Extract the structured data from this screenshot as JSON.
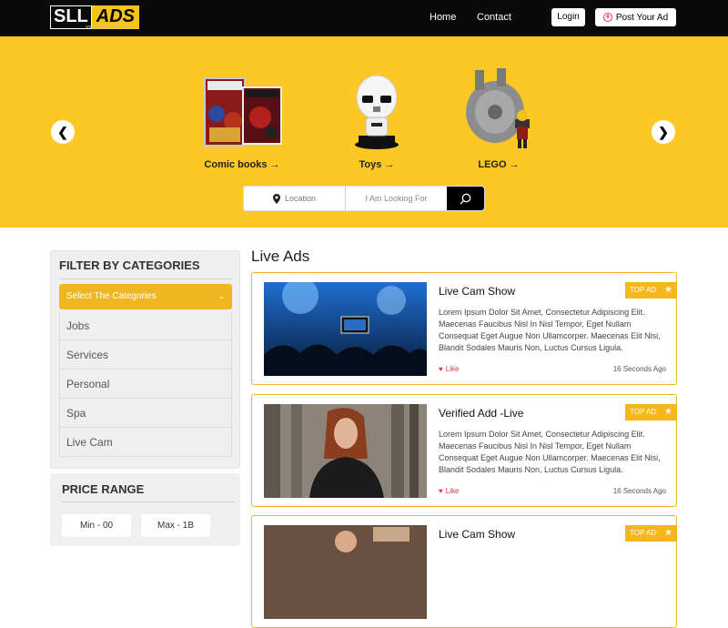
{
  "header": {
    "logo_left": "SLL",
    "logo_right": "ADS",
    "logo_sub": "www.sllanlca-ads.com",
    "nav": [
      "Home",
      "Contact"
    ],
    "login_label": "Login",
    "post_label": "Post Your Ad"
  },
  "hero": {
    "categories": [
      {
        "label": "Comic books",
        "icon": "comic-books-image"
      },
      {
        "label": "Toys",
        "icon": "stormtrooper-toy-image"
      },
      {
        "label": "LEGO",
        "icon": "lego-ship-image"
      }
    ],
    "search": {
      "location_placeholder": "Location",
      "query_placeholder": "I Am Looking For"
    }
  },
  "sidebar": {
    "title": "FILTER BY CATEGORIES",
    "select_label": "Select  The Categories",
    "items": [
      "Jobs",
      "Services",
      "Personal",
      "Spa",
      "Live Cam"
    ]
  },
  "price": {
    "title": "PRICE RANGE",
    "min": "Min - 00",
    "max": "Max - 1B"
  },
  "main": {
    "title": "Live Ads",
    "ads": [
      {
        "title": "Live Cam Show",
        "badge": "TOP AD",
        "desc": "Lorem Ipsum Dolor Sit Amet, Consectetur Adipiscing Elit. Maecenas Faucibus Nisl In Nisl Tempor, Eget Nullam Consequat Eget Augue Non Ullamcorper. Maecenas Elit Nisi, Blandit Sodales Mauris Non, Luctus Cursus Ligula.",
        "like": "Like",
        "time": "16 Seconds Ago"
      },
      {
        "title": "Verified Add -Live",
        "badge": "TOP AD",
        "desc": "Lorem Ipsum Dolor Sit Amet, Consectetur Adipiscing Elit. Maecenas Faucibus Nisl In Nisl Tempor, Eget Nullam Consequat Eget Augue Non Ullamcorper. Maecenas Elit Nisi, Blandit Sodales Mauris Non, Luctus Cursus Ligula.",
        "like": "Like",
        "time": "16 Seconds Ago"
      },
      {
        "title": "Live Cam Show",
        "badge": "TOP AD"
      }
    ]
  },
  "colors": {
    "hero_bg": "#fdc825",
    "accent": "#f0b722",
    "header_bg": "#0a0a0a",
    "like": "#e0394b"
  }
}
